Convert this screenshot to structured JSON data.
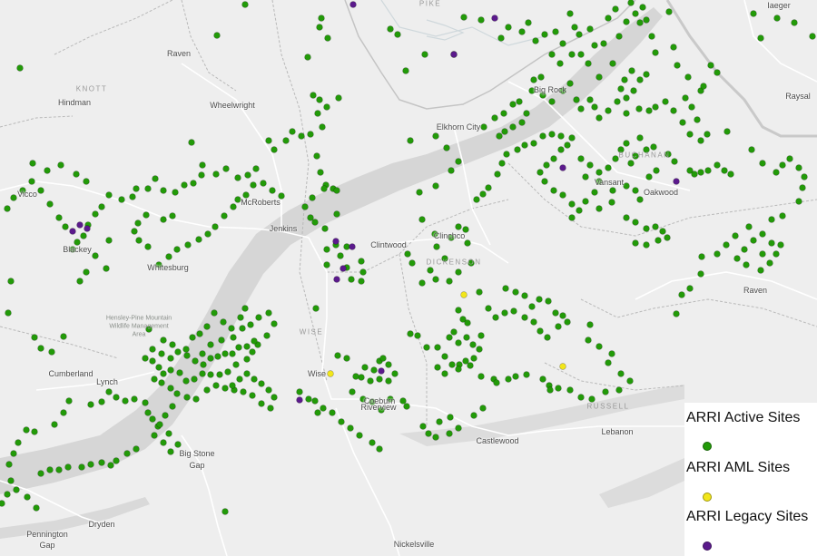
{
  "colors": {
    "background": "#eeeeee",
    "mountain": "#d6d6d6",
    "road": "#ffffff",
    "boundary": "#b9b9b9",
    "active": "#229a08",
    "aml": "#f2e61a",
    "legacy": "#5b1a8c"
  },
  "places": [
    {
      "label": "Raven"
    },
    {
      "label": "Hindman"
    },
    {
      "label": "Wheelwright"
    },
    {
      "label": "Vicco"
    },
    {
      "label": "McRoberts"
    },
    {
      "label": "Jenkins"
    },
    {
      "label": "Blackey"
    },
    {
      "label": "Whitesburg"
    },
    {
      "label": "Clintwood"
    },
    {
      "label": "Clinchco"
    },
    {
      "label": "Elkhorn City"
    },
    {
      "label": "Big Rock"
    },
    {
      "label": "Vansant"
    },
    {
      "label": "Oakwood"
    },
    {
      "label": "Iaeger"
    },
    {
      "label": "Raysal"
    },
    {
      "label": "Raven"
    },
    {
      "label": "Cumberland"
    },
    {
      "label": "Lynch"
    },
    {
      "label": "Big Stone"
    },
    {
      "label": "Gap"
    },
    {
      "label": "Wise"
    },
    {
      "label": "Coeburn"
    },
    {
      "label": "Riverview"
    },
    {
      "label": "Castlewood"
    },
    {
      "label": "Lebanon"
    },
    {
      "label": "Dryden"
    },
    {
      "label": "Pennington"
    },
    {
      "label": "Gap"
    },
    {
      "label": "Nickelsville"
    }
  ],
  "regions": [
    {
      "label": "KNOTT"
    },
    {
      "label": "PIKE"
    },
    {
      "label": "DICKENSON"
    },
    {
      "label": "BUCHANAN"
    },
    {
      "label": "WISE"
    },
    {
      "label": "RUSSELL"
    }
  ],
  "areas": [
    {
      "label": "Hensley-Pine Mountain Wildlife Management Area"
    }
  ],
  "legend": {
    "items": [
      {
        "label": "ARRI Active Sites",
        "color": "#229a08"
      },
      {
        "label": "ARRI AML Sites",
        "color": "#f2e61a"
      },
      {
        "label": "ARRI Legacy Sites",
        "color": "#5b1a8c"
      }
    ]
  }
}
